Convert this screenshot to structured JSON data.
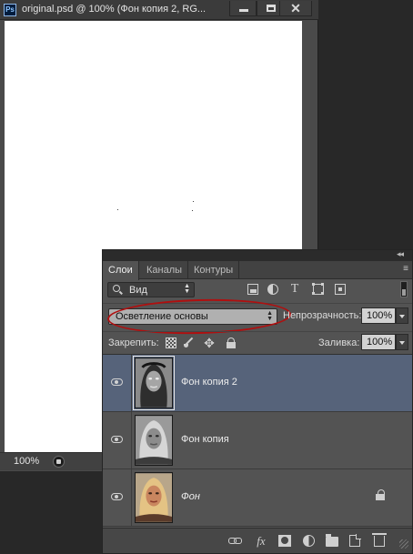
{
  "document": {
    "title": "original.psd @ 100% (Фон копия 2, RG...",
    "app_icon": "Ps",
    "zoom": "100%",
    "window_buttons": {
      "close": "✕"
    }
  },
  "layers_panel": {
    "collapse_arrows": "◂◂",
    "menu_icon": "≡",
    "tabs": [
      {
        "label": "Слои"
      },
      {
        "label": "Каналы"
      },
      {
        "label": "Контуры"
      }
    ],
    "filter": {
      "kind_label": "Вид"
    },
    "filter_icons": {
      "text": "T",
      "move": "✥"
    },
    "blend_mode": "Осветление основы",
    "opacity_label": "Непрозрачность:",
    "opacity_value": "100%",
    "lock_label": "Закрепить:",
    "fill_label": "Заливка:",
    "fill_value": "100%",
    "layers": [
      {
        "name": "Фон копия 2",
        "selected": true,
        "visible": true,
        "thumb": "inverted-portrait"
      },
      {
        "name": "Фон копия",
        "selected": false,
        "visible": true,
        "thumb": "grayscale-portrait"
      },
      {
        "name": "Фон",
        "selected": false,
        "visible": true,
        "thumb": "color-portrait",
        "locked": true
      }
    ],
    "bottom_icons": {
      "fx": "fx"
    }
  },
  "colors": {
    "selection": "#56637a",
    "highlight_ring": "#b00f0f",
    "panel_bg": "#535353"
  }
}
